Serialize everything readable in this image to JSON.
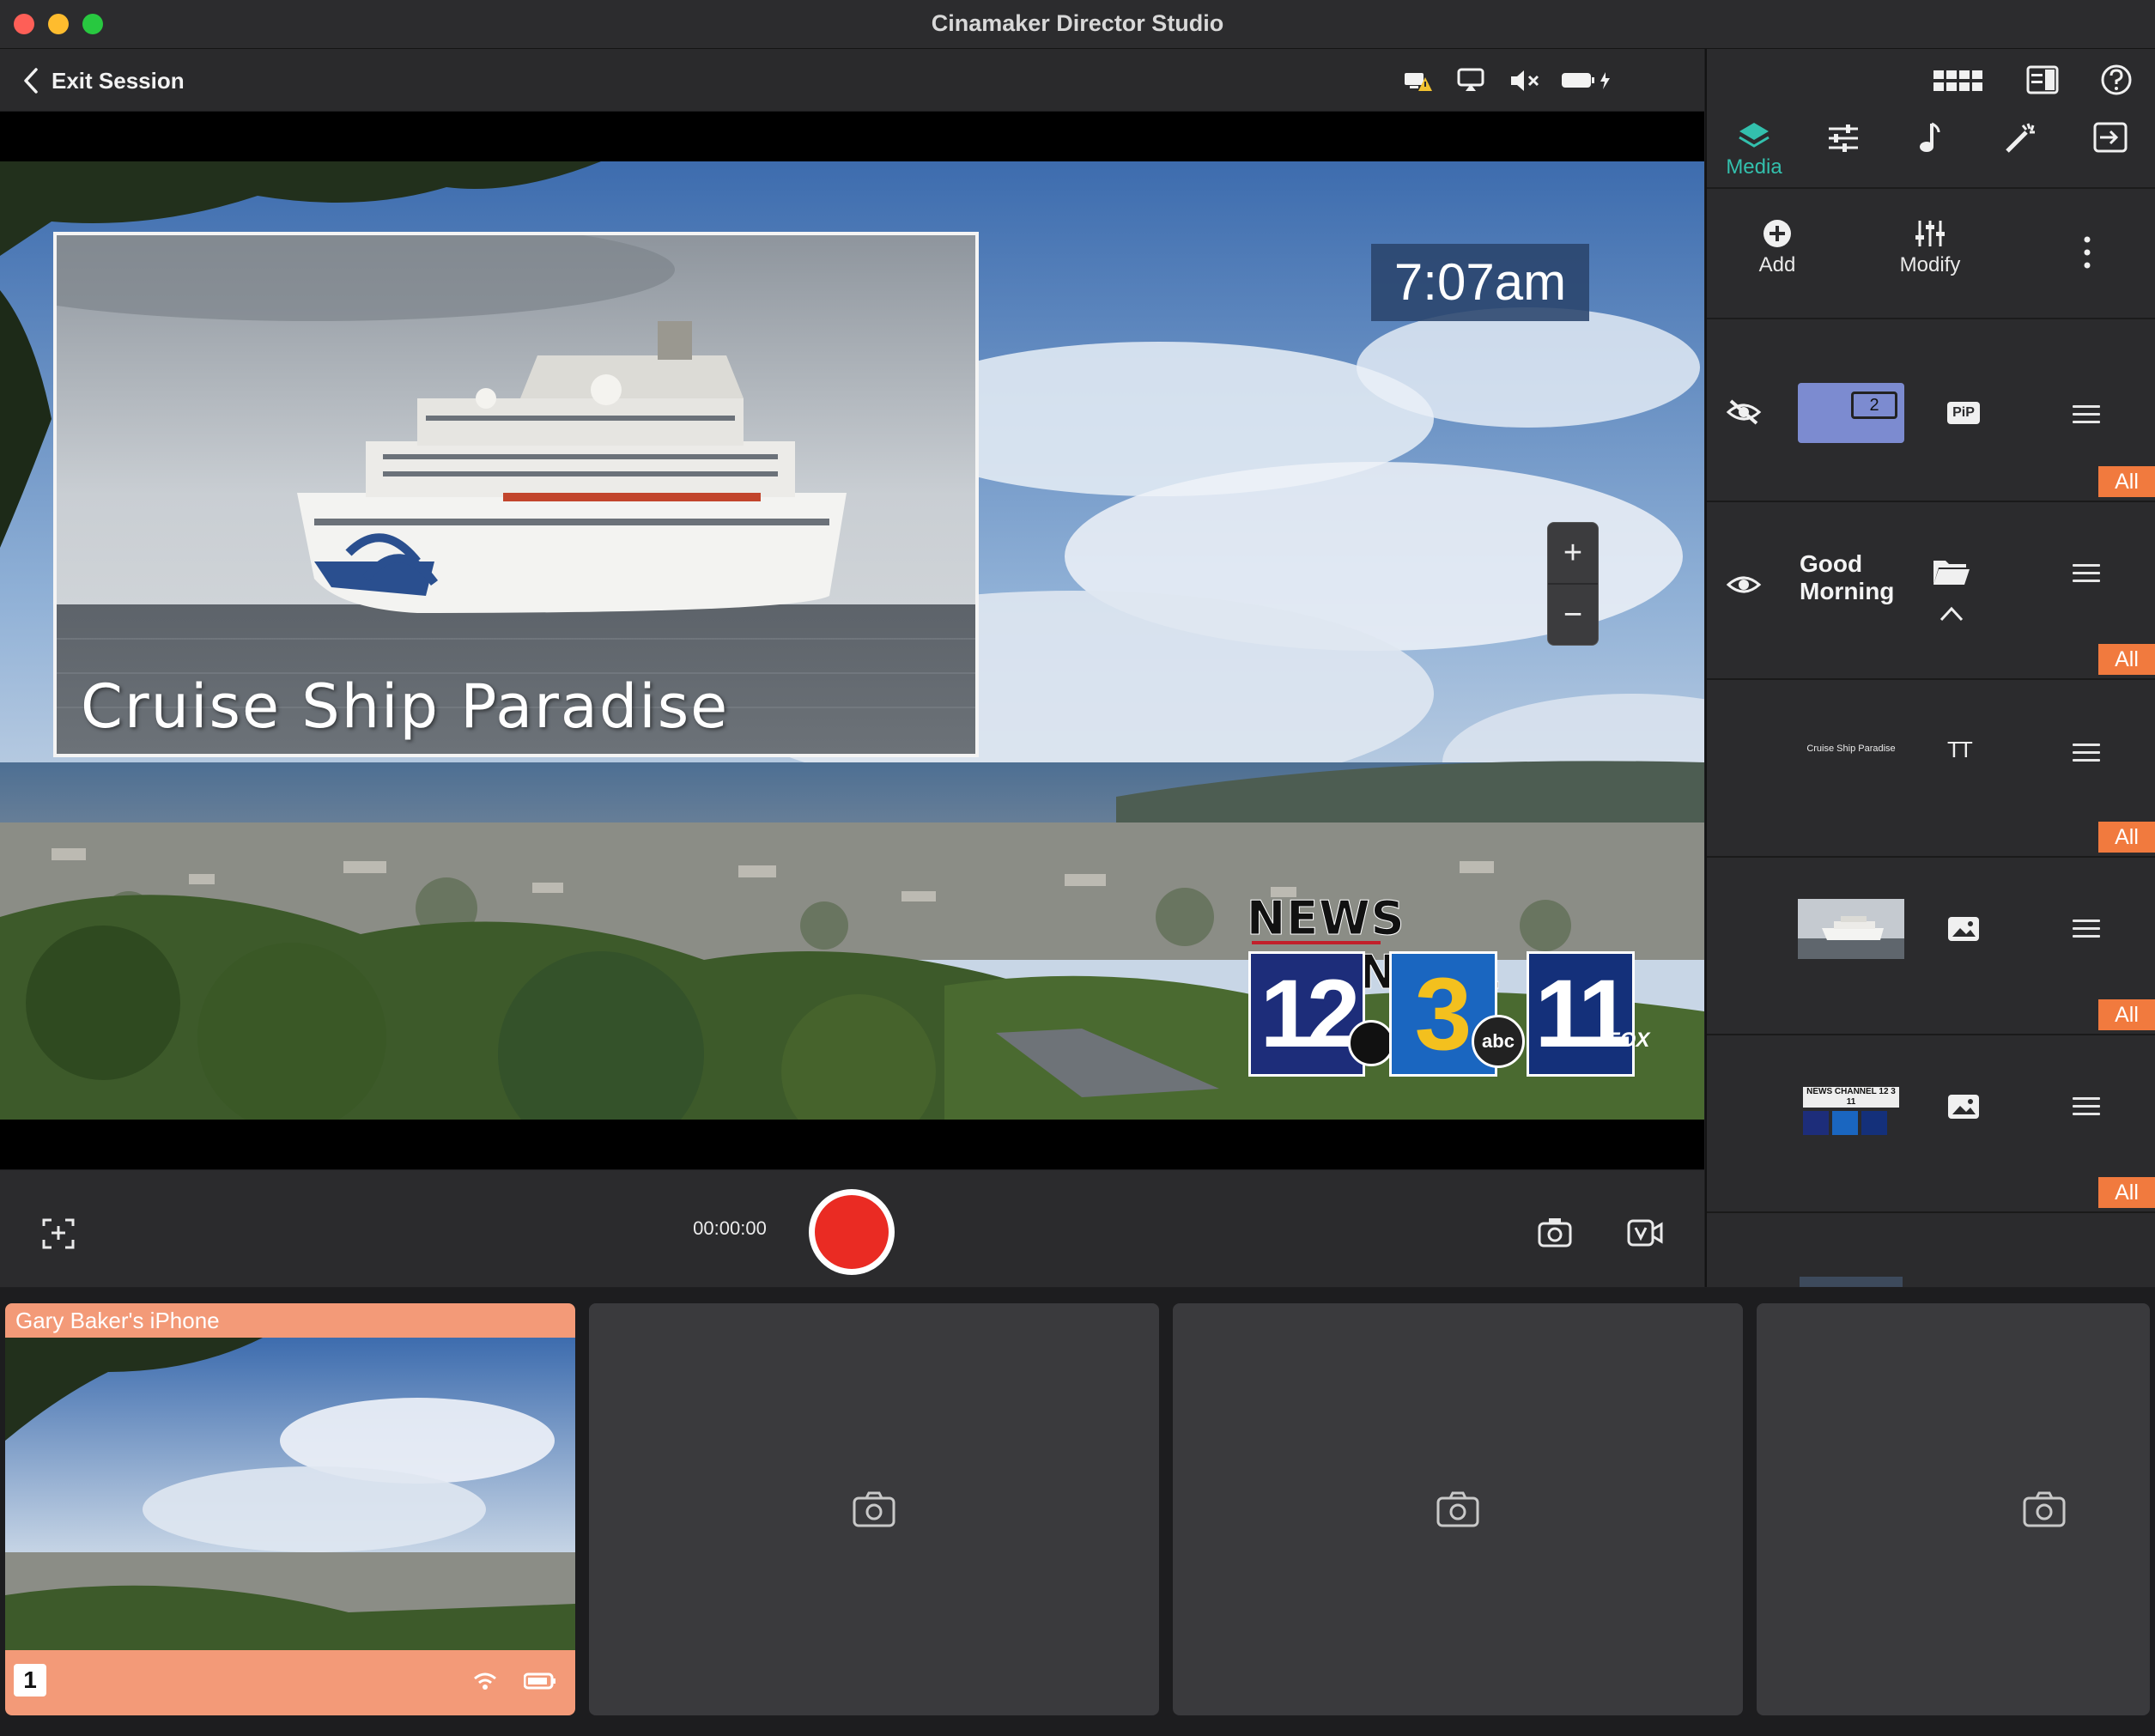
{
  "window": {
    "title": "Cinamaker Director Studio"
  },
  "toolbar": {
    "exit_label": "Exit Session",
    "status_icons": [
      "monitor-warning-icon",
      "airplay-icon",
      "speaker-muted-icon",
      "battery-charging-icon"
    ]
  },
  "preview": {
    "pip_caption": "Cruise Ship Paradise",
    "clock_text": "7:07am",
    "logo": {
      "headline": "NEWS CHANNEL",
      "num1": "12",
      "num2": "3",
      "num3": "11",
      "net1": "CBS",
      "net2": "abc",
      "net3": "FOX"
    },
    "zoom": {
      "in": "+",
      "out": "−"
    }
  },
  "recording": {
    "timecode": "00:00:00"
  },
  "sidebar": {
    "top_icons": [
      "multiview-grid-icon",
      "layout-icon",
      "help-icon"
    ],
    "tabs": [
      {
        "id": "media",
        "label": "Media",
        "icon": "layers-icon",
        "active": true
      },
      {
        "id": "adjust",
        "label": "",
        "icon": "sliders-icon"
      },
      {
        "id": "audio",
        "label": "",
        "icon": "music-note-icon"
      },
      {
        "id": "effects",
        "label": "",
        "icon": "magic-wand-icon"
      },
      {
        "id": "output",
        "label": "",
        "icon": "export-icon"
      }
    ],
    "actions": {
      "add_label": "Add",
      "modify_label": "Modify"
    },
    "layers": [
      {
        "name": "pip-layer",
        "visible": false,
        "thumb_badge": "2",
        "type_badge": "PiP",
        "scope": "All"
      },
      {
        "name": "folder-layer",
        "visible": true,
        "title": "Good Morning",
        "scope": "All"
      },
      {
        "name": "text-layer",
        "thumb_text": "Cruise Ship Paradise",
        "type_badge": "TT",
        "scope": "All"
      },
      {
        "name": "image-layer-ship",
        "scope": "All"
      },
      {
        "name": "image-layer-logo",
        "thumb_text": "NEWS CHANNEL 12 3 11",
        "scope": "All"
      }
    ]
  },
  "cameras": [
    {
      "label": "Gary Baker's iPhone",
      "number": "1",
      "active": true
    },
    {
      "label": "",
      "active": false
    },
    {
      "label": "",
      "active": false
    },
    {
      "label": "",
      "active": false
    }
  ],
  "colors": {
    "accent": "#33c0ad",
    "record": "#ea2b23",
    "badge": "#f17a3e",
    "camera_active": "#f39a78",
    "pip_thumb": "#7c8bd0"
  }
}
